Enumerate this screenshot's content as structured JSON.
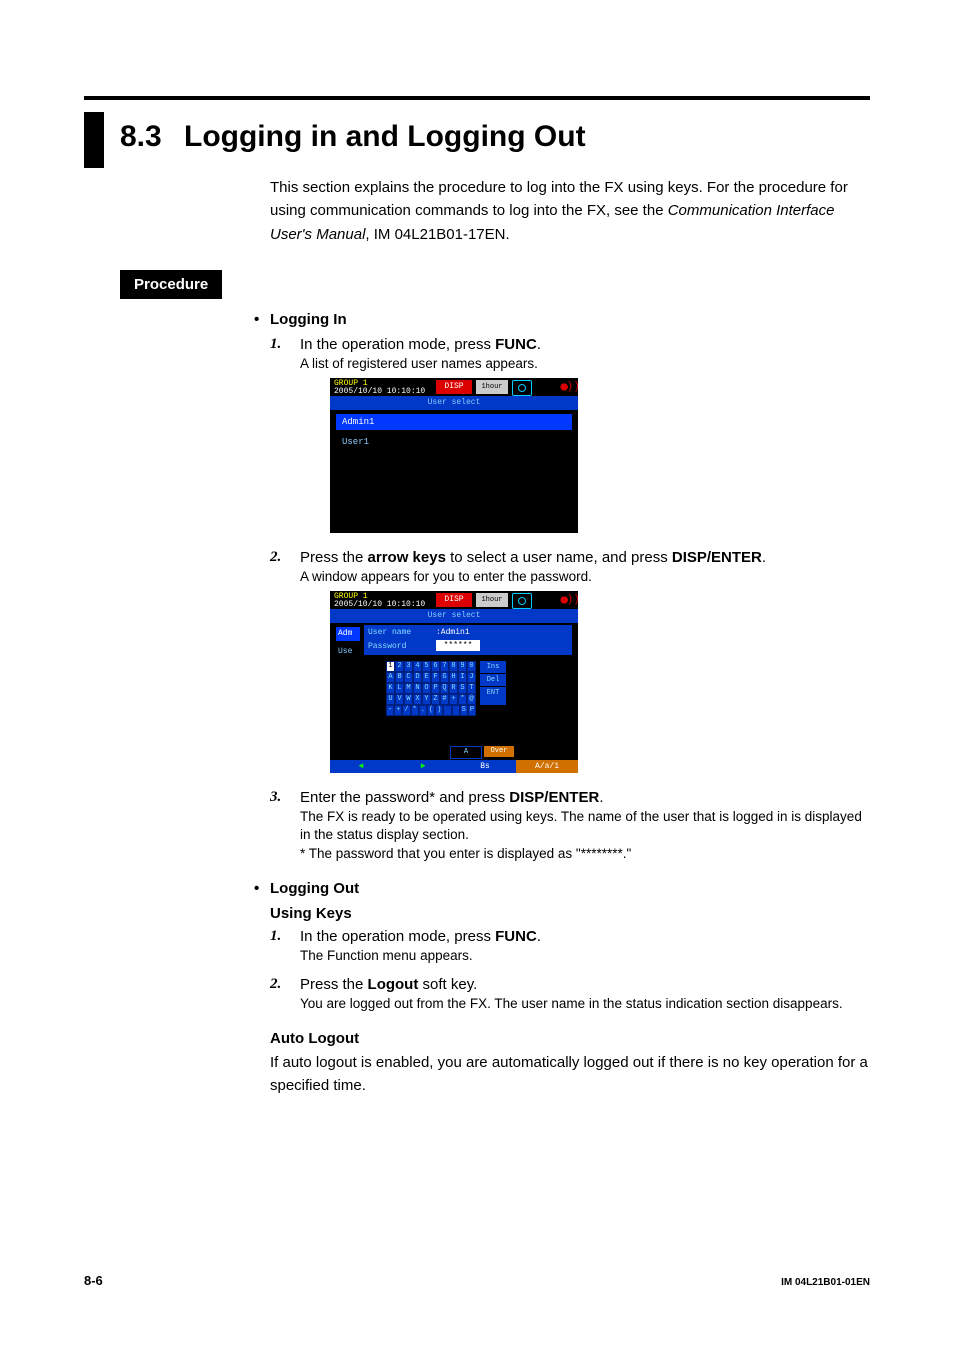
{
  "chapter_num": "8.3",
  "chapter_title": "Logging in and Logging Out",
  "intro": {
    "p1a": "This section explains the procedure to log into the FX using keys. For the procedure for using communication commands to log into the FX, see the ",
    "p1b": "Communication Interface User's Manual",
    "p1c": ", IM 04L21B01-17EN."
  },
  "procedure_label": "Procedure",
  "login": {
    "heading": "Logging In",
    "step1": {
      "num": "1.",
      "a": "In the operation mode, press ",
      "b": "FUNC",
      "c": ".",
      "sub": "A list of registered user names appears."
    },
    "shot1": {
      "group": "GROUP 1",
      "datetime": "2005/10/10 10:10:10",
      "disp": "DISP",
      "tick": "1hour",
      "title": "User select",
      "row_sel": "Admin1",
      "row2": "User1"
    },
    "step2": {
      "num": "2.",
      "a": "Press the ",
      "b": "arrow keys",
      "c": " to select a user name, and press ",
      "d": "DISP/ENTER",
      "e": ".",
      "sub": "A window appears for you to enter the password."
    },
    "shot2": {
      "group": "GROUP 1",
      "datetime": "2005/10/10 10:10:10",
      "disp": "DISP",
      "tick": "1hour",
      "title": "User select",
      "side_sel": "Adm",
      "side_row": "Use",
      "lbl_user": "User name",
      "val_user": ":Admin1",
      "lbl_pass": "Password",
      "val_pass": "******",
      "ins": "Ins",
      "del": "Del",
      "ent": "ENT",
      "btn_a": "A",
      "btn_over": "Over",
      "bar_bs": "Bs",
      "bar_aa1": "A/a/1",
      "krow1": "1234567890",
      "krow2": "ABCDEFGHIJ",
      "krow3": "KLMNOPQRST",
      "krow4": "UVWXYZ#+*@",
      "krow5": "-+/*.()  SP"
    },
    "step3": {
      "num": "3.",
      "a": "Enter the password* and press ",
      "b": "DISP/ENTER",
      "c": ".",
      "sub1": "The FX is ready to be operated using keys. The name of the user that is logged in is displayed in the status display section.",
      "note": "* The password that you enter is displayed as \"********.\""
    }
  },
  "logout": {
    "heading": "Logging Out",
    "subhead": "Using Keys",
    "step1": {
      "num": "1.",
      "a": "In the operation mode, press ",
      "b": "FUNC",
      "c": ".",
      "sub": "The Function menu appears."
    },
    "step2": {
      "num": "2.",
      "a": "Press the ",
      "b": "Logout",
      "c": " soft key.",
      "sub": "You are logged out from the FX. The user name in the status indication section disappears."
    },
    "auto_head": "Auto Logout",
    "auto_body": "If auto logout is enabled, you are automatically logged out if there is no key operation for a specified time."
  },
  "footer": {
    "left": "8-6",
    "right": "IM 04L21B01-01EN"
  }
}
